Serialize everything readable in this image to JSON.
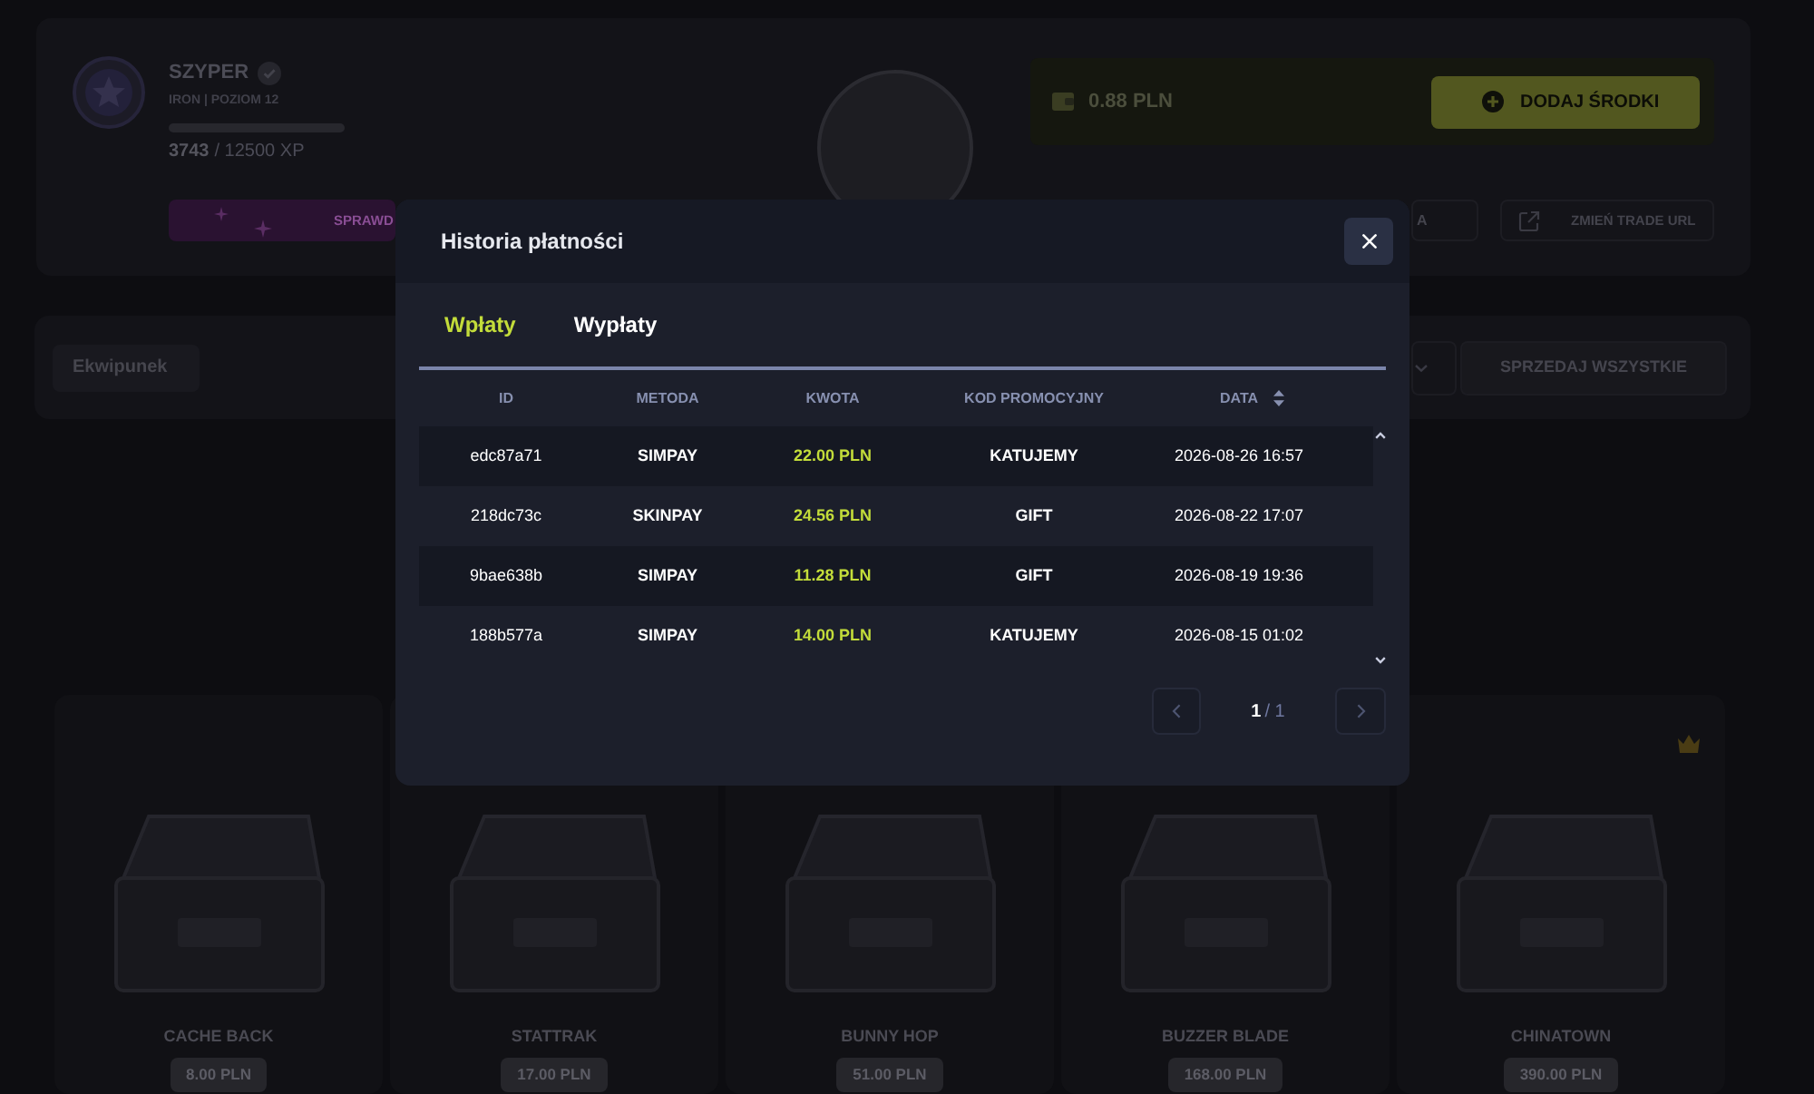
{
  "profile": {
    "name": "SZYPER",
    "verified": true,
    "rank": "IRON | POZIOM 12",
    "xp_current": "3743",
    "xp_total": "/ 12500 XP"
  },
  "balance": {
    "amount": "0.88 PLN",
    "button": "DODAJ ŚRODKI"
  },
  "actions": [
    {
      "label": "SPRAWD",
      "kind": "promo"
    },
    {
      "label": "A",
      "kind": "plain"
    },
    {
      "label": "ZMIEŃ TRADE URL",
      "kind": "link"
    }
  ],
  "inventory_bar": {
    "tab": "Ekwipunek",
    "button": "SPRZEDAJ WSZYSTKIE"
  },
  "cases": [
    {
      "name": "CACHE BACK",
      "price": "8.00 PLN",
      "featured": false
    },
    {
      "name": "STATTRAK",
      "price": "17.00 PLN",
      "featured": false
    },
    {
      "name": "BUNNY HOP",
      "price": "51.00 PLN",
      "featured": false
    },
    {
      "name": "BUZZER BLADE",
      "price": "168.00 PLN",
      "featured": false
    },
    {
      "name": "CHINATOWN",
      "price": "390.00 PLN",
      "featured": true
    }
  ],
  "modal": {
    "title": "Historia płatności",
    "tabs": [
      {
        "label": "Wpłaty",
        "selected": true
      },
      {
        "label": "Wypłaty",
        "selected": false
      }
    ],
    "table": {
      "columns": [
        {
          "label": "ID",
          "kind": "id",
          "sortable": false
        },
        {
          "label": "METODA",
          "kind": "label",
          "sortable": false
        },
        {
          "label": "KWOTA",
          "kind": "amount",
          "sortable": false
        },
        {
          "label": "KOD PROMOCYJNY",
          "kind": "label",
          "sortable": false
        },
        {
          "label": "DATA",
          "kind": "date",
          "sortable": true
        }
      ],
      "rows": [
        [
          "edc87a71",
          "SIMPAY",
          "22.00 PLN",
          "KATUJEMY",
          "2026-08-26 16:57"
        ],
        [
          "218dc73c",
          "SKINPAY",
          "24.56 PLN",
          "GIFT",
          "2026-08-22 17:07"
        ],
        [
          "9bae638b",
          "SIMPAY",
          "11.28 PLN",
          "GIFT",
          "2026-08-19 19:36"
        ],
        [
          "188b577a",
          "SIMPAY",
          "14.00 PLN",
          "KATUJEMY",
          "2026-08-15 01:02"
        ]
      ]
    },
    "pagination": {
      "current": "1",
      "total": "/ 1"
    }
  }
}
